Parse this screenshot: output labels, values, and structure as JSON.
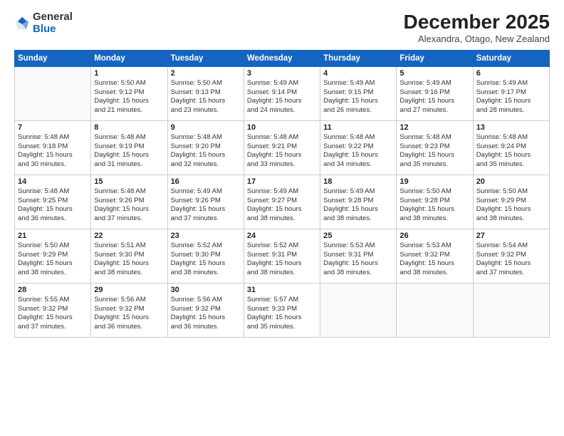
{
  "header": {
    "logo": {
      "line1": "General",
      "line2": "Blue"
    },
    "month": "December 2025",
    "location": "Alexandra, Otago, New Zealand"
  },
  "weekdays": [
    "Sunday",
    "Monday",
    "Tuesday",
    "Wednesday",
    "Thursday",
    "Friday",
    "Saturday"
  ],
  "weeks": [
    [
      {
        "day": "",
        "info": ""
      },
      {
        "day": "1",
        "info": "Sunrise: 5:50 AM\nSunset: 9:12 PM\nDaylight: 15 hours\nand 21 minutes."
      },
      {
        "day": "2",
        "info": "Sunrise: 5:50 AM\nSunset: 9:13 PM\nDaylight: 15 hours\nand 23 minutes."
      },
      {
        "day": "3",
        "info": "Sunrise: 5:49 AM\nSunset: 9:14 PM\nDaylight: 15 hours\nand 24 minutes."
      },
      {
        "day": "4",
        "info": "Sunrise: 5:49 AM\nSunset: 9:15 PM\nDaylight: 15 hours\nand 26 minutes."
      },
      {
        "day": "5",
        "info": "Sunrise: 5:49 AM\nSunset: 9:16 PM\nDaylight: 15 hours\nand 27 minutes."
      },
      {
        "day": "6",
        "info": "Sunrise: 5:49 AM\nSunset: 9:17 PM\nDaylight: 15 hours\nand 28 minutes."
      }
    ],
    [
      {
        "day": "7",
        "info": "Sunrise: 5:48 AM\nSunset: 9:18 PM\nDaylight: 15 hours\nand 30 minutes."
      },
      {
        "day": "8",
        "info": "Sunrise: 5:48 AM\nSunset: 9:19 PM\nDaylight: 15 hours\nand 31 minutes."
      },
      {
        "day": "9",
        "info": "Sunrise: 5:48 AM\nSunset: 9:20 PM\nDaylight: 15 hours\nand 32 minutes."
      },
      {
        "day": "10",
        "info": "Sunrise: 5:48 AM\nSunset: 9:21 PM\nDaylight: 15 hours\nand 33 minutes."
      },
      {
        "day": "11",
        "info": "Sunrise: 5:48 AM\nSunset: 9:22 PM\nDaylight: 15 hours\nand 34 minutes."
      },
      {
        "day": "12",
        "info": "Sunrise: 5:48 AM\nSunset: 9:23 PM\nDaylight: 15 hours\nand 35 minutes."
      },
      {
        "day": "13",
        "info": "Sunrise: 5:48 AM\nSunset: 9:24 PM\nDaylight: 15 hours\nand 35 minutes."
      }
    ],
    [
      {
        "day": "14",
        "info": "Sunrise: 5:48 AM\nSunset: 9:25 PM\nDaylight: 15 hours\nand 36 minutes."
      },
      {
        "day": "15",
        "info": "Sunrise: 5:48 AM\nSunset: 9:26 PM\nDaylight: 15 hours\nand 37 minutes."
      },
      {
        "day": "16",
        "info": "Sunrise: 5:49 AM\nSunset: 9:26 PM\nDaylight: 15 hours\nand 37 minutes."
      },
      {
        "day": "17",
        "info": "Sunrise: 5:49 AM\nSunset: 9:27 PM\nDaylight: 15 hours\nand 38 minutes."
      },
      {
        "day": "18",
        "info": "Sunrise: 5:49 AM\nSunset: 9:28 PM\nDaylight: 15 hours\nand 38 minutes."
      },
      {
        "day": "19",
        "info": "Sunrise: 5:50 AM\nSunset: 9:28 PM\nDaylight: 15 hours\nand 38 minutes."
      },
      {
        "day": "20",
        "info": "Sunrise: 5:50 AM\nSunset: 9:29 PM\nDaylight: 15 hours\nand 38 minutes."
      }
    ],
    [
      {
        "day": "21",
        "info": "Sunrise: 5:50 AM\nSunset: 9:29 PM\nDaylight: 15 hours\nand 38 minutes."
      },
      {
        "day": "22",
        "info": "Sunrise: 5:51 AM\nSunset: 9:30 PM\nDaylight: 15 hours\nand 38 minutes."
      },
      {
        "day": "23",
        "info": "Sunrise: 5:52 AM\nSunset: 9:30 PM\nDaylight: 15 hours\nand 38 minutes."
      },
      {
        "day": "24",
        "info": "Sunrise: 5:52 AM\nSunset: 9:31 PM\nDaylight: 15 hours\nand 38 minutes."
      },
      {
        "day": "25",
        "info": "Sunrise: 5:53 AM\nSunset: 9:31 PM\nDaylight: 15 hours\nand 38 minutes."
      },
      {
        "day": "26",
        "info": "Sunrise: 5:53 AM\nSunset: 9:32 PM\nDaylight: 15 hours\nand 38 minutes."
      },
      {
        "day": "27",
        "info": "Sunrise: 5:54 AM\nSunset: 9:32 PM\nDaylight: 15 hours\nand 37 minutes."
      }
    ],
    [
      {
        "day": "28",
        "info": "Sunrise: 5:55 AM\nSunset: 9:32 PM\nDaylight: 15 hours\nand 37 minutes."
      },
      {
        "day": "29",
        "info": "Sunrise: 5:56 AM\nSunset: 9:32 PM\nDaylight: 15 hours\nand 36 minutes."
      },
      {
        "day": "30",
        "info": "Sunrise: 5:56 AM\nSunset: 9:32 PM\nDaylight: 15 hours\nand 36 minutes."
      },
      {
        "day": "31",
        "info": "Sunrise: 5:57 AM\nSunset: 9:33 PM\nDaylight: 15 hours\nand 35 minutes."
      },
      {
        "day": "",
        "info": ""
      },
      {
        "day": "",
        "info": ""
      },
      {
        "day": "",
        "info": ""
      }
    ]
  ]
}
